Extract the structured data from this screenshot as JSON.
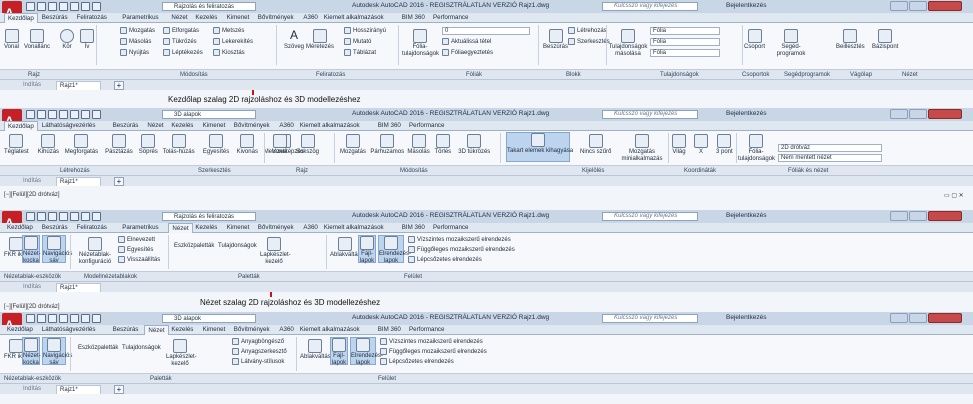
{
  "common": {
    "search_placeholder": "Kulcsszó vagy kifejezés",
    "signin": "Bejelentkezés",
    "file_tab_start": "Indítás",
    "file_tab_drawing": "Rajz1*",
    "file_tab_close": "×",
    "plus": "+"
  },
  "panel1": {
    "doc_selector": "Rajzolás és feliratozás",
    "title": "Autodesk AutoCAD 2016 - REGISZTRÁLATLAN VERZIÓ   Rajz1.dwg",
    "tabs": [
      "Kezdőlap",
      "Beszúrás",
      "Feliratozás",
      "Parametrikus",
      "Nézet",
      "Kezelés",
      "Kimenet",
      "Bővítmények",
      "A360",
      "Kiemelt alkalmazások",
      "BIM 360",
      "Performance"
    ],
    "draw_buttons": [
      "Vonal",
      "Vonallánc",
      "Kör",
      "Ív"
    ],
    "modify_rows": [
      "Mozgatás",
      "Elforgatás",
      "Metszés",
      "Másolás",
      "Tükrözés",
      "Lekerekítés",
      "Nyújtás",
      "Léptékezés",
      "Kiosztás"
    ],
    "annot_buttons": [
      "Szöveg",
      "Méretezés"
    ],
    "annot_rows": [
      "Hosszirányú",
      "Mutató",
      "Táblázat"
    ],
    "layers_button": "Fólia-tulajdonságok",
    "layers_combo": "0",
    "layers_rows": [
      "Aktuálissá tétel",
      "Fóliaegyeztetés"
    ],
    "block_button": "Beszúrás",
    "block_rows": [
      "Létrehozás",
      "Szerkesztés"
    ],
    "props_button": "Tulajdonságok másolása",
    "props_combos": [
      "Fólia",
      "Fólia",
      "Fólia"
    ],
    "right_buttons": [
      "Csoport",
      "Segéd-programok",
      "Beillesztés",
      "Bázispont"
    ],
    "group_labels": [
      "Rajz",
      "Módosítás",
      "Feliratozás",
      "Fóliák",
      "Blokk",
      "Tulajdonságok",
      "Csoportok",
      "Segédprogramok",
      "Vágólap",
      "Nézet"
    ],
    "caption": "Kezdőlap szalag 2D rajzoláshoz és 3D modellezéshez"
  },
  "panel2": {
    "doc_selector": "3D alapok",
    "title": "Autodesk AutoCAD 2016 - REGISZTRÁLATLAN VERZIÓ   Rajz1.dwg",
    "tabs": [
      "Kezdőlap",
      "Láthatóságvezérlés",
      "Beszúrás",
      "Nézet",
      "Kezelés",
      "Kimenet",
      "Bővítmények",
      "A360",
      "Kiemelt alkalmazások",
      "BIM 360",
      "Performance"
    ],
    "create_buttons": [
      "Téglatest",
      "Kihúzás",
      "Megforgatás",
      "Pásztázás",
      "Söprés",
      "Tolás-húzás",
      "Egyesítés",
      "Kivonás",
      "Metszetképzés"
    ],
    "draw_buttons": [
      "Vonal",
      "Sokszög"
    ],
    "modify_buttons": [
      "Mozgatás",
      "Párhuzamos",
      "Másolás",
      "Törlés",
      "3D tükrözés"
    ],
    "select_buttons": [
      "Takart elemek kihagyása",
      "Nincs szűrő",
      "Mozgatás minialkalmazás"
    ],
    "coord_buttons": [
      "Világ",
      "X",
      "3 pont"
    ],
    "layers_button": "Fólia-tulajdonságok",
    "layers_rows": [
      "2D drótváz",
      "Nem mentett nézet"
    ],
    "group_labels": [
      "Létrehozás",
      "Szerkesztés",
      "Rajz",
      "Módosítás",
      "Kijelölés",
      "Koordináták",
      "Fóliák és nézet"
    ],
    "viewport_label": "[−][Felül][2D drótváz]"
  },
  "panel3": {
    "doc_selector": "Rajzolás és feliratozás",
    "title": "Autodesk AutoCAD 2016 - REGISZTRÁLATLAN VERZIÓ   Rajz1.dwg",
    "tabs": [
      "Kezdőlap",
      "Beszúrás",
      "Feliratozás",
      "Parametrikus",
      "Nézet",
      "Kezelés",
      "Kimenet",
      "Bővítmények",
      "A360",
      "Kiemelt alkalmazások",
      "BIM 360",
      "Performance"
    ],
    "viewport_buttons": [
      "FKR ikon",
      "Nézet-kocka",
      "Navigációs sáv"
    ],
    "model_buttons": [
      "Nézetablak-konfiguráció"
    ],
    "model_rows": [
      "Elnevezett",
      "Egyesítés",
      "Visszaállítás"
    ],
    "palette_buttons": [
      "Eszközpaletták",
      "Tulajdonságok",
      "Lapkészlet-kezelő"
    ],
    "ui_buttons": [
      "Ablakváltás",
      "Fájl-lapok",
      "Elrendezés-lapok"
    ],
    "ui_rows": [
      "Vízszintes mozaikszerű elrendezés",
      "Függőleges mozaikszerű elrendezés",
      "Lépcsőzetes elrendezés"
    ],
    "group_labels": [
      "Nézetablak-eszközök",
      "Modellnézetablakok",
      "Paletták",
      "Felület"
    ],
    "caption": "Nézet szalag 2D rajzoláshoz és 3D modellezéshez",
    "viewport_label": "[−][Felül][2D drótváz]"
  },
  "panel4": {
    "doc_selector": "3D alapok",
    "title": "Autodesk AutoCAD 2016 - REGISZTRÁLATLAN VERZIÓ   Rajz1.dwg",
    "tabs": [
      "Kezdőlap",
      "Láthatóságvezérlés",
      "Beszúrás",
      "Nézet",
      "Kezelés",
      "Kimenet",
      "Bővítmények",
      "A360",
      "Kiemelt alkalmazások",
      "BIM 360",
      "Performance"
    ],
    "viewport_buttons": [
      "FKR ikon",
      "Nézet-kocka",
      "Navigációs sáv"
    ],
    "palette_buttons": [
      "Eszközpaletták",
      "Tulajdonságok",
      "Lapkészlet-kezelő"
    ],
    "palette_rows": [
      "Anyagböngésző",
      "Anyagszerkesztő",
      "Látvány-stílusok"
    ],
    "ui_buttons": [
      "Ablakváltás",
      "Fájl-lapok",
      "Elrendezés-lapok"
    ],
    "ui_rows": [
      "Vízszintes mozaikszerű elrendezés",
      "Függőleges mozaikszerű elrendezés",
      "Lépcsőzetes elrendezés"
    ],
    "group_labels": [
      "Nézetablak-eszközök",
      "Paletták",
      "Felület"
    ]
  }
}
